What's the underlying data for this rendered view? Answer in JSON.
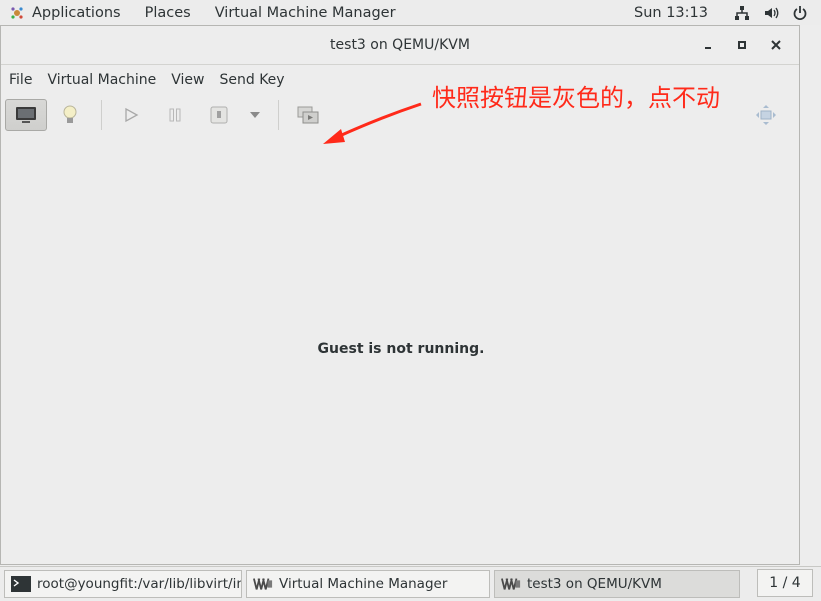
{
  "top_panel": {
    "applications": "Applications",
    "places": "Places",
    "active_app": "Virtual Machine Manager",
    "clock": "Sun 13:13"
  },
  "window": {
    "title": "test3 on QEMU/KVM",
    "menu": [
      "File",
      "Virtual Machine",
      "View",
      "Send Key"
    ],
    "annotation": "快照按钮是灰色的，点不动",
    "annotation_color": "#ff2a1a",
    "status_message": "Guest is not running."
  },
  "taskbar": {
    "tasks": [
      {
        "label": "root@youngfit:/var/lib/libvirt/ima..."
      },
      {
        "label": "Virtual Machine Manager"
      },
      {
        "label": "test3 on QEMU/KVM"
      }
    ],
    "workspace": "1 / 4"
  },
  "icons": {
    "toolbar": [
      "console-icon",
      "lightbulb-icon",
      "play-icon",
      "pause-icon",
      "shutdown-icon",
      "chevron-down-icon",
      "snapshot-icon",
      "fullscreen-icon"
    ]
  }
}
